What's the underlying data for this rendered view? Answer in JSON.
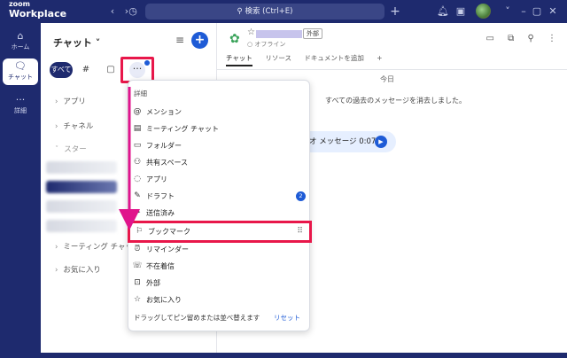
{
  "titlebar": {
    "logo_line1": "zoom",
    "logo_line2": "Workplace",
    "search_text": "検索 (Ctrl+E)",
    "icons": [
      "back-icon",
      "forward-icon",
      "history-icon",
      "search-icon",
      "add-icon",
      "bell-icon",
      "apps-icon",
      "avatar"
    ]
  },
  "rail": {
    "items": [
      {
        "label": "ホーム",
        "icon": "home-icon"
      },
      {
        "label": "チャット",
        "icon": "chat-icon",
        "active": true
      },
      {
        "label": "詳細",
        "icon": "more-icon"
      }
    ]
  },
  "panel": {
    "title": "チャット ˅",
    "new_button": "+",
    "chips": {
      "all": "すべて",
      "channels": "#",
      "chat": "▢",
      "more": "···"
    },
    "sections": [
      {
        "label": "アプリ"
      },
      {
        "label": "チャネル"
      },
      {
        "label": "スター"
      },
      {
        "label": "ミーティング チャット"
      },
      {
        "label": "お気に入り"
      }
    ]
  },
  "conversation": {
    "badge": "外部",
    "status": "○ オフライン",
    "tabs": [
      "チャット",
      "リソース",
      "ドキュメントを追加",
      "+"
    ],
    "today": "今日",
    "cleared_message": "すべての過去のメッセージを消去しました。",
    "voice_message": "オ メッセージ 0:07"
  },
  "menu": {
    "header": "詳細",
    "items": [
      {
        "label": "メンション",
        "icon": "at-icon"
      },
      {
        "label": "ミーティング チャット",
        "icon": "calendar-icon"
      },
      {
        "label": "フォルダー",
        "icon": "folder-icon"
      },
      {
        "label": "共有スペース",
        "icon": "shared-space-icon"
      },
      {
        "label": "アプリ",
        "icon": "app-icon"
      },
      {
        "label": "ドラフト",
        "icon": "draft-icon",
        "badge": "2"
      },
      {
        "label": "送信済み",
        "icon": "sent-icon"
      },
      {
        "label": "ブックマーク",
        "icon": "bookmark-icon",
        "highlighted": true
      },
      {
        "label": "リマインダー",
        "icon": "alarm-icon"
      },
      {
        "label": "不在着信",
        "icon": "missed-call-icon"
      },
      {
        "label": "外部",
        "icon": "external-icon"
      },
      {
        "label": "お気に入り",
        "icon": "favorite-icon"
      }
    ],
    "footer": "ドラッグしてピン留めまたは並べ替えます",
    "reset": "リセット"
  },
  "colors": {
    "brand_navy": "#1e2a6e",
    "accent_blue": "#1e5bd6",
    "annotation_red": "#e8174a",
    "annotation_arrow": "#e0148c"
  }
}
